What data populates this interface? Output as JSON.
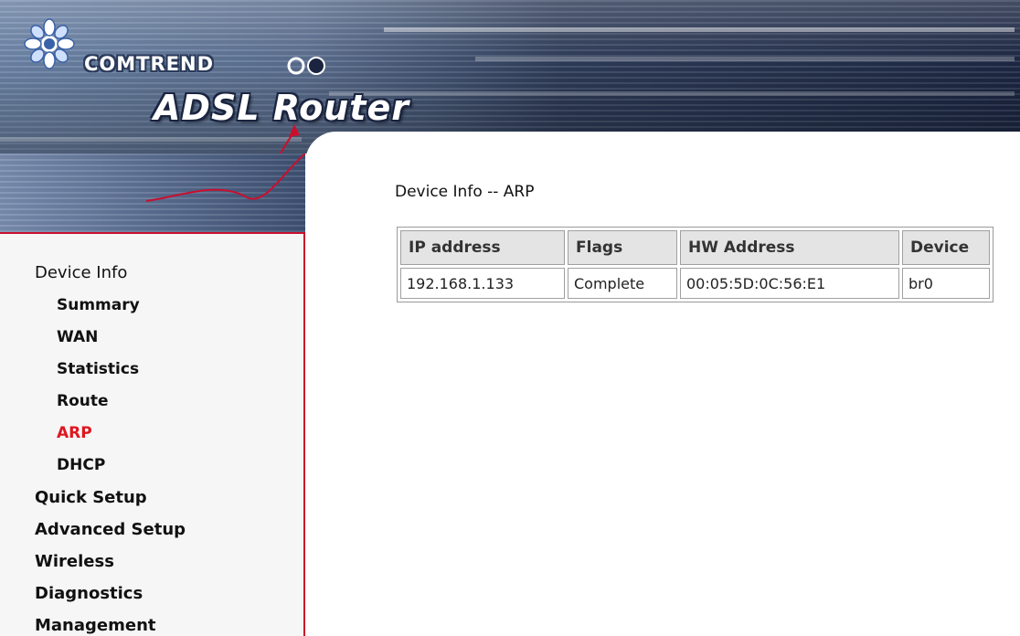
{
  "header": {
    "brand": "COMTREND",
    "product_title": "ADSL Router"
  },
  "sidebar": {
    "items": [
      {
        "label": "Device Info",
        "level": "top"
      },
      {
        "label": "Summary",
        "level": "sub"
      },
      {
        "label": "WAN",
        "level": "sub"
      },
      {
        "label": "Statistics",
        "level": "sub"
      },
      {
        "label": "Route",
        "level": "sub"
      },
      {
        "label": "ARP",
        "level": "sub",
        "active": true
      },
      {
        "label": "DHCP",
        "level": "sub"
      },
      {
        "label": "Quick Setup",
        "level": "top"
      },
      {
        "label": "Advanced Setup",
        "level": "top"
      },
      {
        "label": "Wireless",
        "level": "top"
      },
      {
        "label": "Diagnostics",
        "level": "top"
      },
      {
        "label": "Management",
        "level": "top"
      }
    ],
    "active_color": "#e0161f",
    "border_color": "#c8102e"
  },
  "main": {
    "title": "Device Info -- ARP",
    "table": {
      "columns": [
        "IP address",
        "Flags",
        "HW Address",
        "Device"
      ],
      "rows": [
        [
          "192.168.1.133",
          "Complete",
          "00:05:5D:0C:56:E1",
          "br0"
        ]
      ]
    }
  },
  "icons": {
    "logo": "comtrend-flower-logo-icon",
    "swoosh": "red-arrow-swoosh-icon"
  }
}
